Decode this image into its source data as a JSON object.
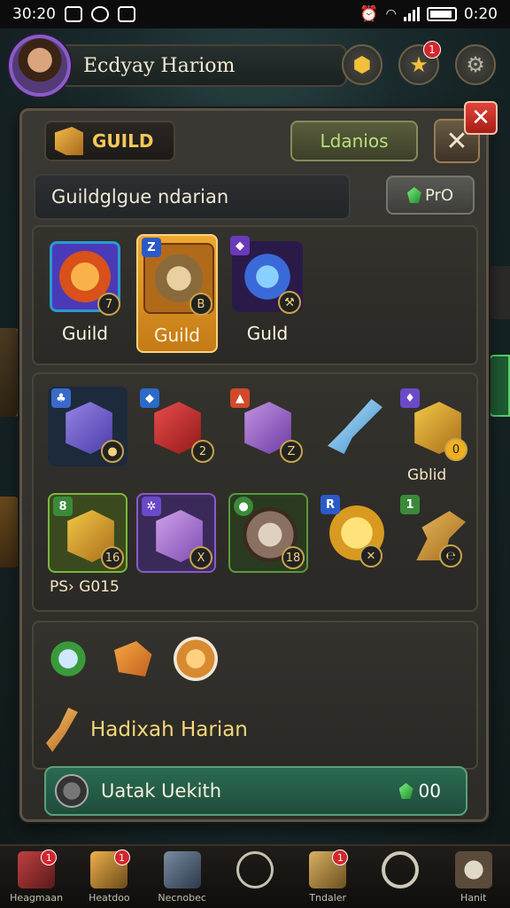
{
  "status_bar": {
    "time_left": "30:20",
    "time_right": "0:20"
  },
  "header": {
    "player_name": "Ecdyay Hariom",
    "notification_count": "1"
  },
  "panel": {
    "tab_label": "GUILD",
    "ldanios_label": "Ldanios",
    "close_glyph": "✕",
    "search_text": "Guildglgue ndarian",
    "pro_label": "PrO"
  },
  "guild_items": [
    {
      "label": "Guild",
      "count": "7",
      "color": "#f05a22"
    },
    {
      "label": "Guild",
      "count": "B",
      "level": "Z",
      "color": "#c8a060"
    },
    {
      "label": "Guld",
      "count": "",
      "color": "#3a6ad8"
    }
  ],
  "rewards_row1": [
    {
      "count": "",
      "color": "#6a5ad0"
    },
    {
      "count": "2",
      "color": "#c03030"
    },
    {
      "count": "Z",
      "color": "#9a6ac8"
    },
    {
      "count": "",
      "color": "#8ac0e8"
    },
    {
      "count": "0",
      "color": "#d8a030"
    }
  ],
  "rewards_row1_caption": "Gblid",
  "rewards_row2": [
    {
      "count": "16",
      "level": "8",
      "color": "#c8a040"
    },
    {
      "count": "X",
      "color": "#8a4ac8"
    },
    {
      "count": "18",
      "color": "#a08070"
    },
    {
      "count": "",
      "level": "R",
      "color": "#f0b020"
    },
    {
      "count": "",
      "level": "1",
      "color": "#d8a040"
    }
  ],
  "rewards_row2_caption": "PS› G015",
  "daily": {
    "title": "Hadixah Harian",
    "claim_label": "Uatak Uekith",
    "claim_value": "00"
  },
  "bottom_nav": [
    {
      "label": "Heagmaan",
      "badge": "1"
    },
    {
      "label": "Heatdoo",
      "badge": "1"
    },
    {
      "label": "Necnobec",
      "badge": ""
    },
    {
      "label": "",
      "badge": ""
    },
    {
      "label": "Tndaler",
      "badge": "1"
    },
    {
      "label": "",
      "badge": ""
    },
    {
      "label": "Hanit",
      "badge": ""
    }
  ]
}
